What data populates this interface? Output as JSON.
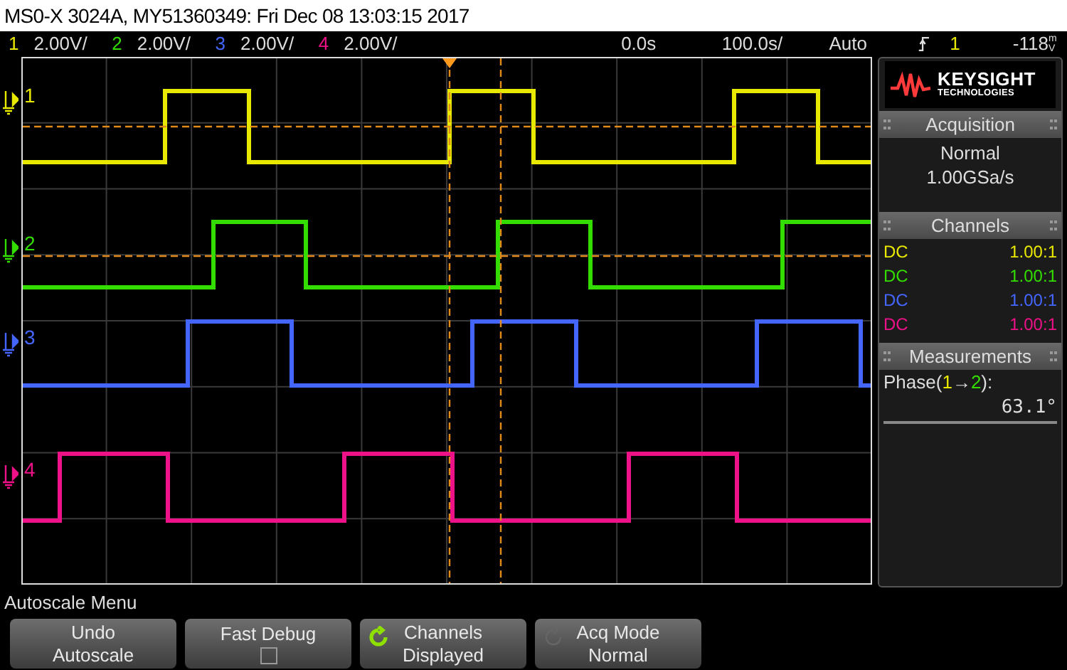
{
  "title": "MS0-X 3024A, MY51360349: Fri Dec 08 13:03:15 2017",
  "channels": [
    {
      "number": "1",
      "scale": "2.00V/",
      "color": "#e8e800",
      "marker": "1",
      "coupling": "DC",
      "probe": "1.00:1"
    },
    {
      "number": "2",
      "scale": "2.00V/",
      "color": "#33dd00",
      "marker": "2",
      "coupling": "DC",
      "probe": "1.00:1"
    },
    {
      "number": "3",
      "scale": "2.00V/",
      "color": "#4466ff",
      "marker": "3",
      "coupling": "DC",
      "probe": "1.00:1"
    },
    {
      "number": "4",
      "scale": "2.00V/",
      "color": "#ee1188",
      "marker": "4",
      "coupling": "DC",
      "probe": "1.00:1"
    }
  ],
  "timebase": {
    "delay": "0.0s",
    "scale": "100.0s/"
  },
  "trigger": {
    "mode": "Auto",
    "source": "1",
    "level": "-118",
    "unit": "mV"
  },
  "logo": {
    "name": "KEYSIGHT",
    "subtitle": "TECHNOLOGIES"
  },
  "acquisition": {
    "heading": "Acquisition",
    "mode": "Normal",
    "rate": "1.00GSa/s"
  },
  "channels_panel": {
    "heading": "Channels"
  },
  "measurements": {
    "heading": "Measurements",
    "label_parts": [
      {
        "text": "Phase("
      },
      {
        "text": "1",
        "color": "#e8e800"
      },
      {
        "text": "→"
      },
      {
        "text": "2",
        "color": "#33dd00"
      },
      {
        "text": "):"
      }
    ],
    "value": "63.1°"
  },
  "menu_title": "Autoscale Menu",
  "softkeys": [
    {
      "kind": "text",
      "line1": "Undo",
      "line2": "Autoscale"
    },
    {
      "kind": "checkbox",
      "line1": "Fast Debug",
      "checked": false
    },
    {
      "kind": "knob",
      "line1": "Channels",
      "line2": "Displayed",
      "disabled": false
    },
    {
      "kind": "knob",
      "line1": "Acq Mode",
      "line2": "Normal",
      "disabled": true
    }
  ]
}
